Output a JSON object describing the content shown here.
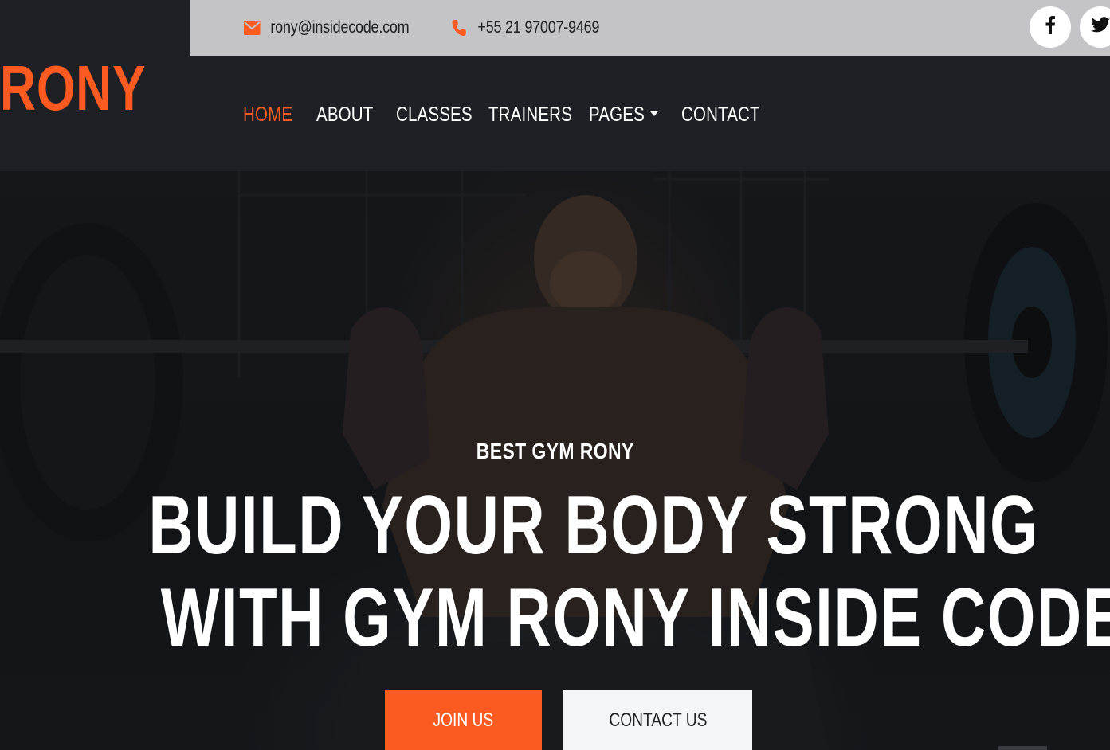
{
  "topbar": {
    "email": "rony@insidecode.com",
    "phone": "+55 21 97007-9469",
    "social": [
      {
        "name": "facebook",
        "glyph": "f"
      },
      {
        "name": "twitter",
        "glyph": "twitter-bird"
      }
    ]
  },
  "brand": {
    "name": "RONY",
    "color": "#fb5b21"
  },
  "nav": {
    "items": [
      {
        "label": "HOME",
        "active": true
      },
      {
        "label": "ABOUT",
        "active": false
      },
      {
        "label": "CLASSES",
        "active": false
      },
      {
        "label": "TRAINERS",
        "active": false
      },
      {
        "label": "PAGES",
        "active": false,
        "dropdown": true
      },
      {
        "label": "CONTACT",
        "active": false
      }
    ]
  },
  "hero": {
    "subtitle": "BEST GYM RONY",
    "title_line_1": "BUILD YOUR BODY STRONG",
    "title_line_2": "WITH GYM RONY INSIDE CODE",
    "primary_button": "JOIN US",
    "secondary_button": "CONTACT US"
  },
  "colors": {
    "accent": "#fb5b21",
    "dark": "#1f2026",
    "topbar": "#c4c4c6"
  }
}
